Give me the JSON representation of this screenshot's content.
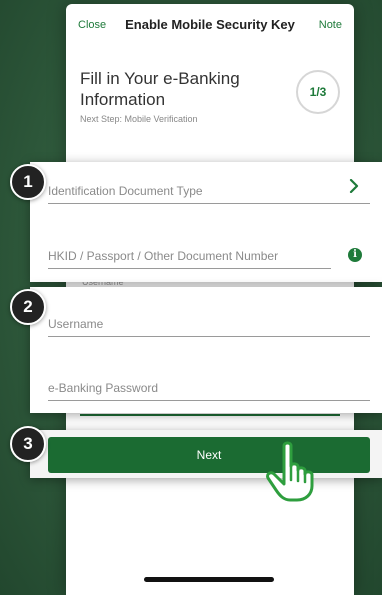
{
  "nav": {
    "close_label": "Close",
    "title": "Enable Mobile Security Key",
    "note_label": "Note"
  },
  "header": {
    "heading": "Fill in Your e-Banking Information",
    "next_step": "Next Step: Mobile Verification",
    "step_indicator": "1/3"
  },
  "background_ghost": {
    "username_label": "Username"
  },
  "step_badges": [
    "1",
    "2",
    "3"
  ],
  "identity_card": {
    "id_type_placeholder": "Identification Document Type",
    "document_number_placeholder": "HKID / Passport / Other Document Number",
    "info_icon_glyph": "i"
  },
  "login_card": {
    "username_placeholder": "Username",
    "password_placeholder": "e-Banking Password"
  },
  "action": {
    "next_label": "Next"
  },
  "colors": {
    "brand_green": "#1e7a3a",
    "button_green": "#1b6b32",
    "badge_dark": "#222222"
  },
  "icons": {
    "chevron": "chevron-right-icon",
    "info": "info-icon",
    "hand": "hand-pointer-icon"
  }
}
